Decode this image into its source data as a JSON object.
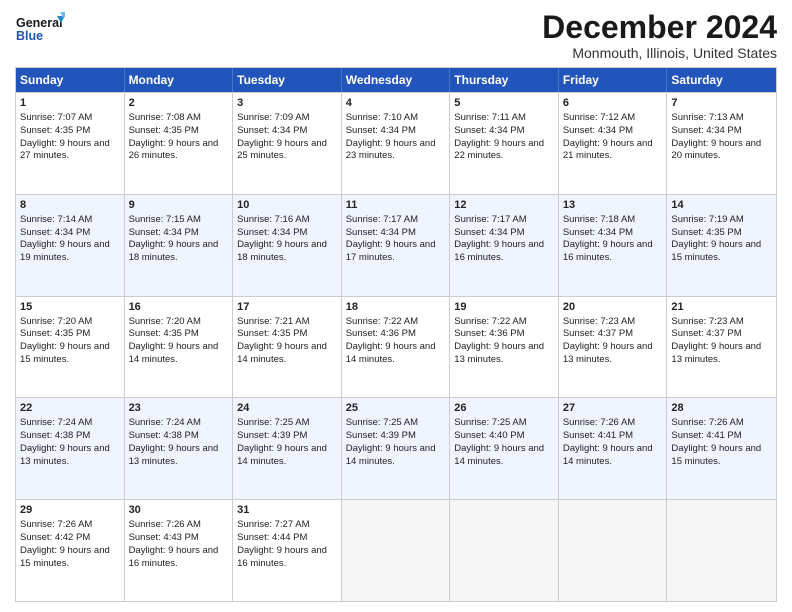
{
  "logo": {
    "line1": "General",
    "line2": "Blue"
  },
  "title": "December 2024",
  "subtitle": "Monmouth, Illinois, United States",
  "days": [
    "Sunday",
    "Monday",
    "Tuesday",
    "Wednesday",
    "Thursday",
    "Friday",
    "Saturday"
  ],
  "weeks": [
    [
      {
        "num": "1",
        "rise": "7:07 AM",
        "set": "4:35 PM",
        "hours": "9 hours and 27 minutes."
      },
      {
        "num": "2",
        "rise": "7:08 AM",
        "set": "4:35 PM",
        "hours": "9 hours and 26 minutes."
      },
      {
        "num": "3",
        "rise": "7:09 AM",
        "set": "4:34 PM",
        "hours": "9 hours and 25 minutes."
      },
      {
        "num": "4",
        "rise": "7:10 AM",
        "set": "4:34 PM",
        "hours": "9 hours and 23 minutes."
      },
      {
        "num": "5",
        "rise": "7:11 AM",
        "set": "4:34 PM",
        "hours": "9 hours and 22 minutes."
      },
      {
        "num": "6",
        "rise": "7:12 AM",
        "set": "4:34 PM",
        "hours": "9 hours and 21 minutes."
      },
      {
        "num": "7",
        "rise": "7:13 AM",
        "set": "4:34 PM",
        "hours": "9 hours and 20 minutes."
      }
    ],
    [
      {
        "num": "8",
        "rise": "7:14 AM",
        "set": "4:34 PM",
        "hours": "9 hours and 19 minutes."
      },
      {
        "num": "9",
        "rise": "7:15 AM",
        "set": "4:34 PM",
        "hours": "9 hours and 18 minutes."
      },
      {
        "num": "10",
        "rise": "7:16 AM",
        "set": "4:34 PM",
        "hours": "9 hours and 18 minutes."
      },
      {
        "num": "11",
        "rise": "7:17 AM",
        "set": "4:34 PM",
        "hours": "9 hours and 17 minutes."
      },
      {
        "num": "12",
        "rise": "7:17 AM",
        "set": "4:34 PM",
        "hours": "9 hours and 16 minutes."
      },
      {
        "num": "13",
        "rise": "7:18 AM",
        "set": "4:34 PM",
        "hours": "9 hours and 16 minutes."
      },
      {
        "num": "14",
        "rise": "7:19 AM",
        "set": "4:35 PM",
        "hours": "9 hours and 15 minutes."
      }
    ],
    [
      {
        "num": "15",
        "rise": "7:20 AM",
        "set": "4:35 PM",
        "hours": "9 hours and 15 minutes."
      },
      {
        "num": "16",
        "rise": "7:20 AM",
        "set": "4:35 PM",
        "hours": "9 hours and 14 minutes."
      },
      {
        "num": "17",
        "rise": "7:21 AM",
        "set": "4:35 PM",
        "hours": "9 hours and 14 minutes."
      },
      {
        "num": "18",
        "rise": "7:22 AM",
        "set": "4:36 PM",
        "hours": "9 hours and 14 minutes."
      },
      {
        "num": "19",
        "rise": "7:22 AM",
        "set": "4:36 PM",
        "hours": "9 hours and 13 minutes."
      },
      {
        "num": "20",
        "rise": "7:23 AM",
        "set": "4:37 PM",
        "hours": "9 hours and 13 minutes."
      },
      {
        "num": "21",
        "rise": "7:23 AM",
        "set": "4:37 PM",
        "hours": "9 hours and 13 minutes."
      }
    ],
    [
      {
        "num": "22",
        "rise": "7:24 AM",
        "set": "4:38 PM",
        "hours": "9 hours and 13 minutes."
      },
      {
        "num": "23",
        "rise": "7:24 AM",
        "set": "4:38 PM",
        "hours": "9 hours and 13 minutes."
      },
      {
        "num": "24",
        "rise": "7:25 AM",
        "set": "4:39 PM",
        "hours": "9 hours and 14 minutes."
      },
      {
        "num": "25",
        "rise": "7:25 AM",
        "set": "4:39 PM",
        "hours": "9 hours and 14 minutes."
      },
      {
        "num": "26",
        "rise": "7:25 AM",
        "set": "4:40 PM",
        "hours": "9 hours and 14 minutes."
      },
      {
        "num": "27",
        "rise": "7:26 AM",
        "set": "4:41 PM",
        "hours": "9 hours and 14 minutes."
      },
      {
        "num": "28",
        "rise": "7:26 AM",
        "set": "4:41 PM",
        "hours": "9 hours and 15 minutes."
      }
    ],
    [
      {
        "num": "29",
        "rise": "7:26 AM",
        "set": "4:42 PM",
        "hours": "9 hours and 15 minutes."
      },
      {
        "num": "30",
        "rise": "7:26 AM",
        "set": "4:43 PM",
        "hours": "9 hours and 16 minutes."
      },
      {
        "num": "31",
        "rise": "7:27 AM",
        "set": "4:44 PM",
        "hours": "9 hours and 16 minutes."
      },
      null,
      null,
      null,
      null
    ]
  ],
  "labels": {
    "sunrise": "Sunrise:",
    "sunset": "Sunset:",
    "daylight": "Daylight:"
  }
}
